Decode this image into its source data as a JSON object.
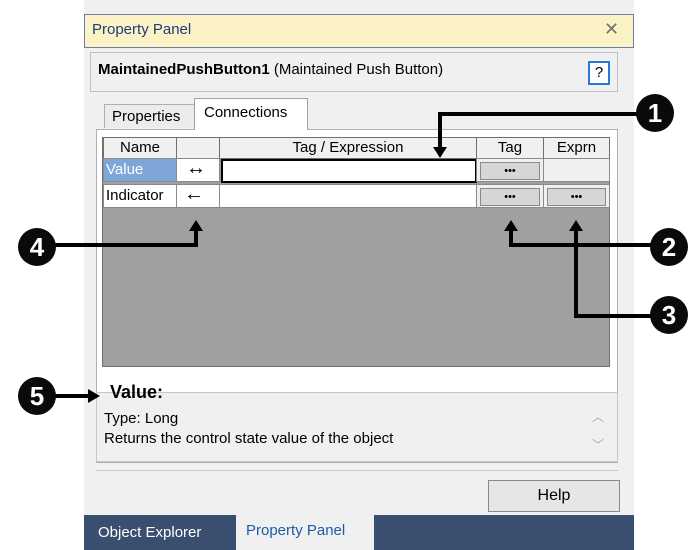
{
  "window": {
    "title": "Property Panel",
    "close_glyph": "✕"
  },
  "object": {
    "name": "MaintainedPushButton1",
    "type": "(Maintained Push Button)",
    "help_label": "?"
  },
  "tabs": [
    {
      "label": "Properties"
    },
    {
      "label": "Connections"
    }
  ],
  "grid": {
    "headers": [
      "Name",
      "",
      "Tag / Expression",
      "Tag",
      "Exprn"
    ],
    "rows": [
      {
        "name": "Value",
        "direction_glyph": "↔",
        "expression": "",
        "tag_button": "•••",
        "exprn_button": ""
      },
      {
        "name": "Indicator",
        "direction_glyph": "←",
        "expression": "",
        "tag_button": "•••",
        "exprn_button": "•••"
      }
    ]
  },
  "description": {
    "heading": "Value:",
    "line1": "Type: Long",
    "line2": "Returns the control state value of the object"
  },
  "help_button": "Help",
  "bottom_tabs": [
    {
      "label": "Object Explorer"
    },
    {
      "label": "Property Panel",
      "active": true
    }
  ],
  "callouts": [
    "1",
    "2",
    "3",
    "4",
    "5"
  ],
  "colors": {
    "titlebar": "#fbf3c6",
    "selection": "#7ea6d8",
    "grid_background": "#a0a0a0",
    "bottom_bar": "#3a4f6f"
  }
}
